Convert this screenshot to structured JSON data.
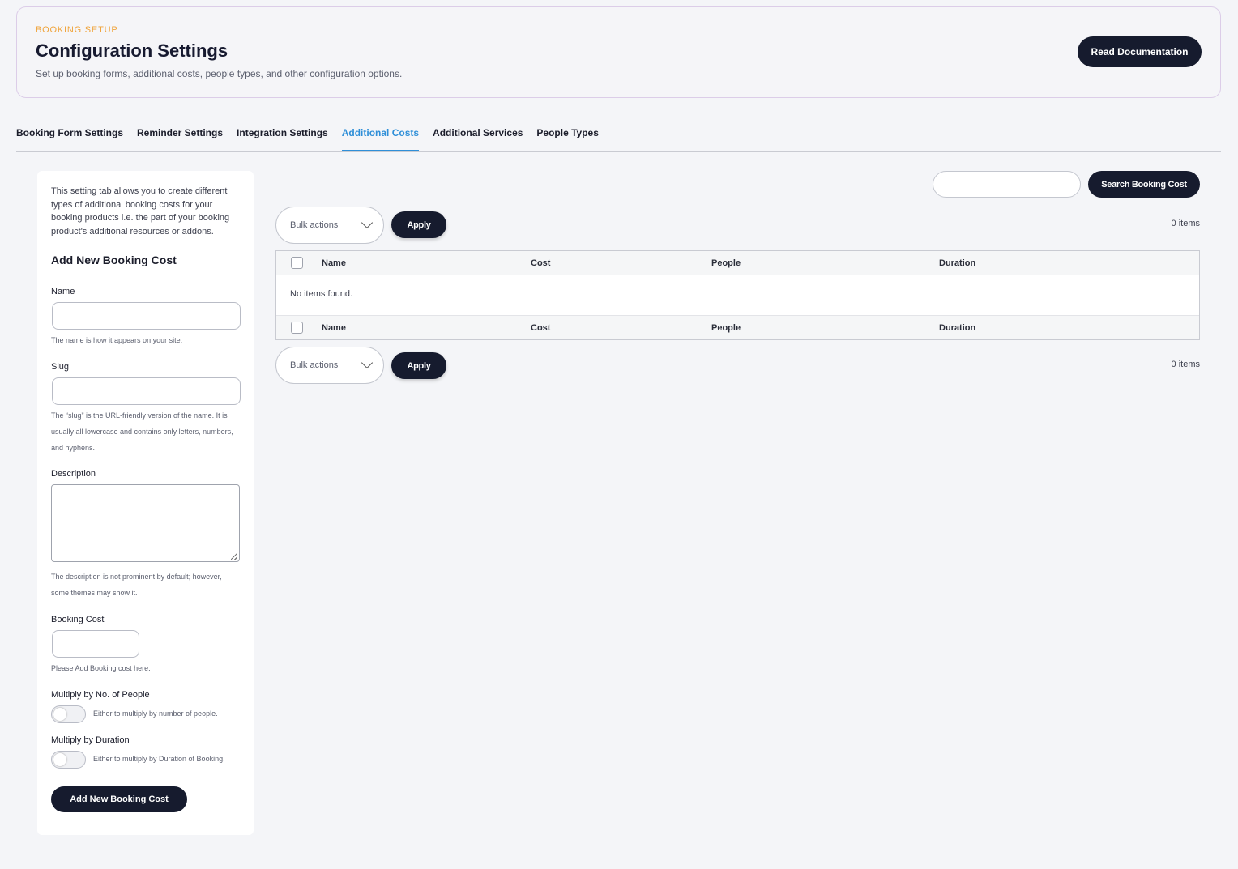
{
  "header": {
    "eyebrow": "BOOKING SETUP",
    "title": "Configuration Settings",
    "subtitle": "Set up booking forms, additional costs, people types, and other configuration options.",
    "doc_button": "Read Documentation"
  },
  "tabs": [
    {
      "label": "Booking Form Settings",
      "active": false
    },
    {
      "label": "Reminder Settings",
      "active": false
    },
    {
      "label": "Integration Settings",
      "active": false
    },
    {
      "label": "Additional Costs",
      "active": true
    },
    {
      "label": "Additional Services",
      "active": false
    },
    {
      "label": "People Types",
      "active": false
    }
  ],
  "form": {
    "intro": "This setting tab allows you to create different types of additional booking costs for your booking products i.e. the part of your booking product's additional resources or addons.",
    "heading": "Add New Booking Cost",
    "name_label": "Name",
    "name_help": "The name is how it appears on your site.",
    "slug_label": "Slug",
    "slug_help": "The “slug” is the URL-friendly version of the name. It is usually all lowercase and contains only letters, numbers, and hyphens.",
    "description_label": "Description",
    "description_help": "The description is not prominent by default; however, some themes may show it.",
    "cost_label": "Booking Cost",
    "cost_help": "Please Add Booking cost here.",
    "multiply_people_label": "Multiply by No. of People",
    "multiply_people_help": "Either to multiply by number of people.",
    "multiply_duration_label": "Multiply by Duration",
    "multiply_duration_help": "Either to multiply by Duration of Booking.",
    "submit_label": "Add New Booking Cost"
  },
  "list": {
    "search_button": "Search Booking Cost",
    "bulk_actions": "Bulk actions",
    "apply": "Apply",
    "items_count": "0 items",
    "columns": [
      "Name",
      "Cost",
      "People",
      "Duration"
    ],
    "empty_message": "No items found."
  },
  "colors": {
    "accent": "#2f8fd8",
    "eyebrow": "#f0a43c",
    "button_dark": "#161b2e"
  }
}
